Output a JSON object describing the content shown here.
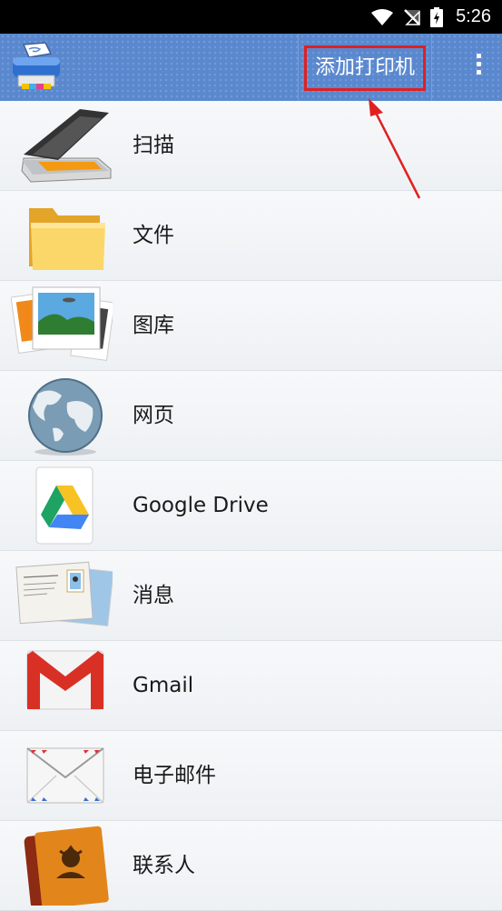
{
  "status_bar": {
    "time": "5:26"
  },
  "app_bar": {
    "add_printer_label": "添加打印机"
  },
  "list": {
    "items": [
      {
        "label": "扫描",
        "icon": "scanner-icon"
      },
      {
        "label": "文件",
        "icon": "folder-icon"
      },
      {
        "label": "图库",
        "icon": "photos-icon"
      },
      {
        "label": "网页",
        "icon": "globe-icon"
      },
      {
        "label": "Google Drive",
        "icon": "google-drive-icon"
      },
      {
        "label": "消息",
        "icon": "postcard-icon"
      },
      {
        "label": "Gmail",
        "icon": "gmail-icon"
      },
      {
        "label": "电子邮件",
        "icon": "envelope-icon"
      },
      {
        "label": "联系人",
        "icon": "contacts-book-icon"
      }
    ]
  },
  "colors": {
    "app_bar": "#5a88cf",
    "highlight": "#e02020"
  }
}
